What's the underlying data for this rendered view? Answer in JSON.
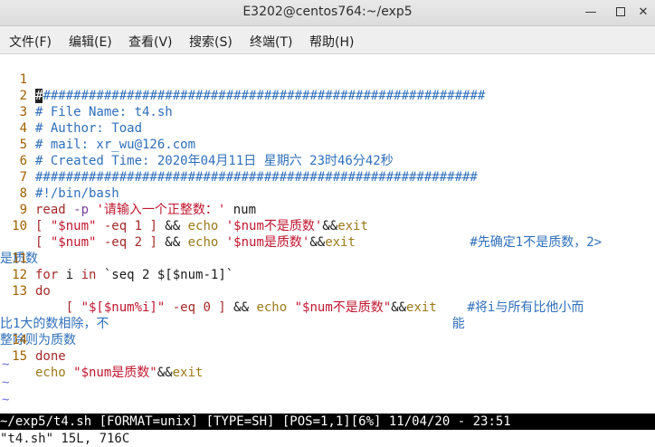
{
  "window": {
    "title": "E3202@centos764:~/exp5"
  },
  "menu": [
    {
      "label": "文件(F)"
    },
    {
      "label": "编辑(E)"
    },
    {
      "label": "查看(V)"
    },
    {
      "label": "搜索(S)"
    },
    {
      "label": "终端(T)"
    },
    {
      "label": "帮助(H)"
    }
  ],
  "editor": {
    "lines": [
      {
        "num": "1",
        "cursor": "#",
        "text": "##########################################################"
      },
      {
        "num": "2",
        "text": "# File Name: t4.sh"
      },
      {
        "num": "3",
        "text": "# Author: Toad"
      },
      {
        "num": "4",
        "text": "# mail: xr_wu@126.com"
      },
      {
        "num": "5",
        "text": "# Created Time: 2020年04月11日 星期六 23时46分42秒"
      },
      {
        "num": "6",
        "text": "##########################################################"
      },
      {
        "num": "7",
        "text": "#!/bin/bash"
      },
      {
        "num": "8",
        "p1": "read",
        "p2": " -p ",
        "p3": "'请输入一个正整数：'",
        "p4": " num"
      },
      {
        "num": "9",
        "p1": "[ ",
        "p2": "\"$num\"",
        "p3": " -eq 1 ]",
        "p4": " && ",
        "p5": "echo",
        "p6": " '$num不是质数'",
        "p7": "&&",
        "p8": "exit"
      },
      {
        "num": "10",
        "p1": "[ ",
        "p2": "\"$num\"",
        "p3": " -eq 2 ]",
        "p4": " && ",
        "p5": "echo",
        "p6": " '$num是质数'",
        "p7": "&&",
        "p8": "exit",
        "p9": "               #先确定1不是质数，2>"
      },
      {
        "num": "",
        "text": "是质数"
      },
      {
        "num": "11",
        "p1": "for",
        "p2": " i ",
        "p3": "in",
        "p4": " `seq 2 $[$num-1]`"
      },
      {
        "num": "12",
        "text": "do"
      },
      {
        "num": "13",
        "p1": "    [ ",
        "p2": "\"$[$num%i]\"",
        "p3": " -eq 0 ]",
        "p4": " && ",
        "p5": "echo",
        "p6": " \"$num不是质数\"",
        "p7": "&&",
        "p8": "exit",
        "p9": "    #将i与所有比他小而"
      },
      {
        "num": "",
        "text": "比1大的数相除，不                                             能"
      },
      {
        "num": "",
        "text": "整除则为质数"
      },
      {
        "num": "14",
        "text": "done"
      },
      {
        "num": "15",
        "p1": "echo",
        "p2": " \"$num是质数\"",
        "p3": "&&",
        "p4": "exit"
      }
    ],
    "tilde": "~"
  },
  "status": {
    "text": "~/exp5/t4.sh [FORMAT=unix] [TYPE=SH] [POS=1,1][6%] 11/04/20 - 23:51",
    "message": "\"t4.sh\" 15L, 716C"
  }
}
